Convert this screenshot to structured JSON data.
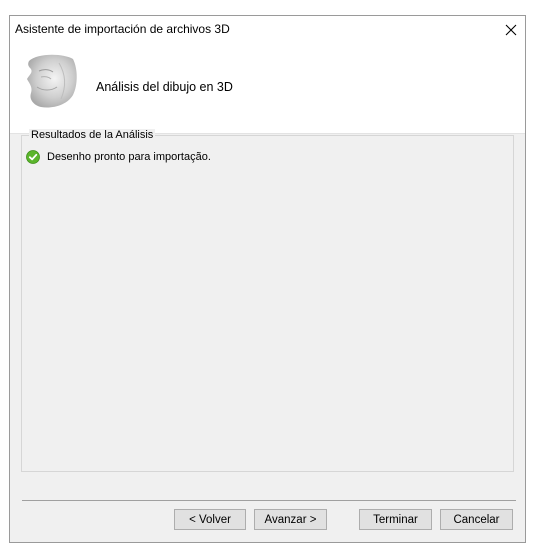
{
  "window": {
    "title": "Asistente de importación de archivos 3D",
    "close_icon": "close-icon"
  },
  "header": {
    "image_icon": "face-relief-image",
    "title": "Análisis del dibujo en 3D"
  },
  "results": {
    "group_label": "Resultados de la Análisis",
    "items": [
      {
        "icon": "check-circle-icon",
        "status_color": "#5bb52c",
        "text": "Desenho pronto para importação."
      }
    ]
  },
  "buttons": {
    "back": "< Volver",
    "next": "Avanzar >",
    "finish": "Terminar",
    "cancel": "Cancelar"
  }
}
